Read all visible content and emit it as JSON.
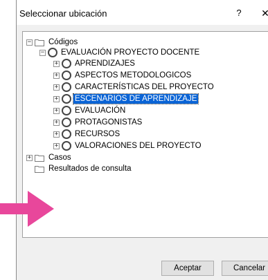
{
  "window": {
    "title": "Seleccionar ubicación",
    "help_glyph": "?",
    "close_glyph": "✕"
  },
  "tree": {
    "root": {
      "label": "Códigos",
      "expander": "−"
    },
    "project": {
      "label": "EVALUACIÓN PROYECTO DOCENTE",
      "expander": "−"
    },
    "children": [
      {
        "label": "APRENDIZAJES",
        "expander": "+"
      },
      {
        "label": "ASPECTOS METODOLOGICOS",
        "expander": "+"
      },
      {
        "label": "CARACTERÍSTICAS DEL PROYECTO",
        "expander": "+"
      },
      {
        "label": "ESCENARIOS DE APRENDIZAJE",
        "expander": "+",
        "selected": true
      },
      {
        "label": "EVALUACIÓN",
        "expander": "+"
      },
      {
        "label": "PROTAGONISTAS",
        "expander": "+"
      },
      {
        "label": "RECURSOS",
        "expander": "+"
      },
      {
        "label": "VALORACIONES DEL PROYECTO",
        "expander": "+"
      }
    ],
    "casos": {
      "label": "Casos",
      "expander": "+"
    },
    "resultados": {
      "label": "Resultados de consulta"
    }
  },
  "buttons": {
    "accept": "Aceptar",
    "cancel": "Cancelar"
  },
  "colors": {
    "selection": "#0a64d6",
    "annotation_arrow": "#e8479b"
  }
}
